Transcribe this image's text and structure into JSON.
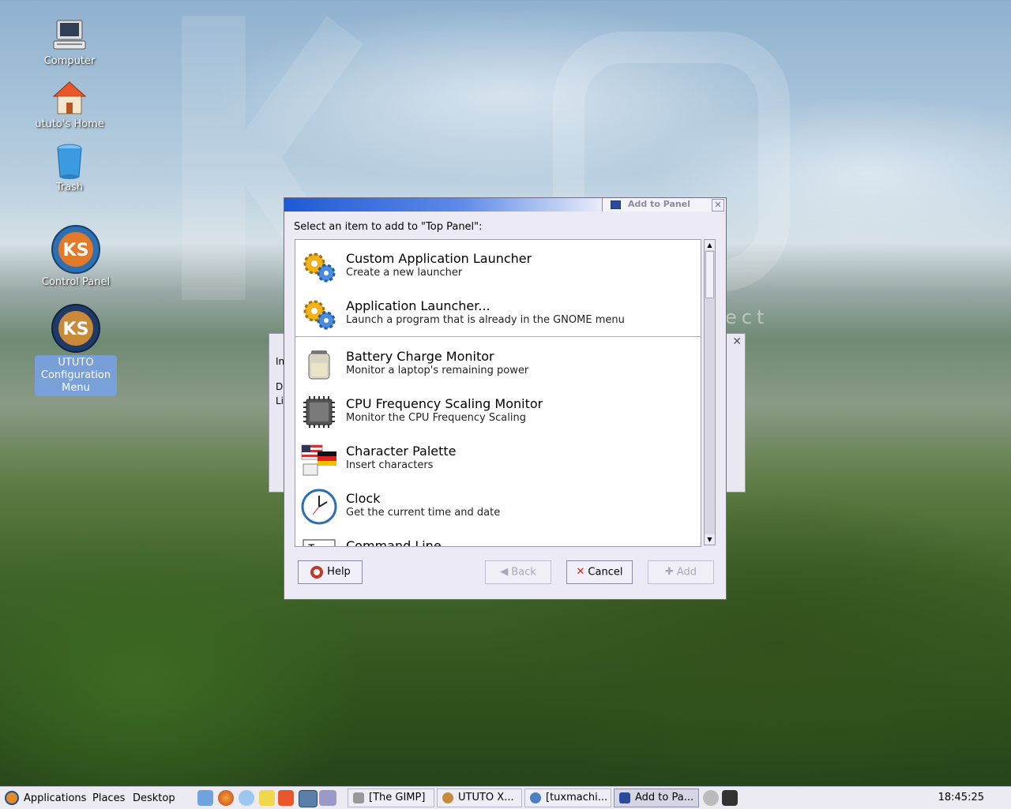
{
  "desktop": {
    "watermark_text": "ect",
    "icons": [
      {
        "label": "Computer",
        "icon": "computer-icon"
      },
      {
        "label": "ututo's Home",
        "icon": "home-folder-icon"
      },
      {
        "label": "Trash",
        "icon": "trash-icon"
      },
      {
        "label": "Control Panel",
        "icon": "control-panel-icon"
      },
      {
        "label": "UTUTO Configuration Menu",
        "icon": "ututo-config-icon"
      }
    ]
  },
  "background_window": {
    "fragments": [
      "In",
      "D",
      "Li"
    ]
  },
  "dialog": {
    "title": "Add to Panel",
    "prompt": "Select an item to add to \"Top Panel\":",
    "items": [
      {
        "name": "Custom Application Launcher",
        "desc": "Create a new launcher",
        "icon": "gears-icon"
      },
      {
        "name": "Application Launcher...",
        "desc": "Launch a program that is already in the GNOME menu",
        "icon": "gears-icon"
      },
      {
        "name": "Battery Charge Monitor",
        "desc": "Monitor a laptop's remaining power",
        "icon": "battery-icon"
      },
      {
        "name": "CPU Frequency Scaling Monitor",
        "desc": "Monitor the CPU Frequency Scaling",
        "icon": "cpu-chip-icon"
      },
      {
        "name": "Character Palette",
        "desc": "Insert characters",
        "icon": "flags-icon"
      },
      {
        "name": "Clock",
        "desc": "Get the current time and date",
        "icon": "clock-icon"
      },
      {
        "name": "Command Line",
        "desc": "",
        "icon": "terminal-icon"
      }
    ],
    "buttons": {
      "help": "Help",
      "back": "Back",
      "cancel": "Cancel",
      "add": "Add"
    }
  },
  "taskbar": {
    "menus": [
      "Applications",
      "Places",
      "Desktop"
    ],
    "tasks": [
      {
        "label": "[The GIMP]",
        "icon": "gimp-icon"
      },
      {
        "label": "UTUTO X...",
        "icon": "ututo-icon"
      },
      {
        "label": "[tuxmachi...",
        "icon": "browser-icon"
      },
      {
        "label": "Add to Pa...",
        "icon": "panel-icon"
      }
    ],
    "clock": "18:45:25"
  }
}
